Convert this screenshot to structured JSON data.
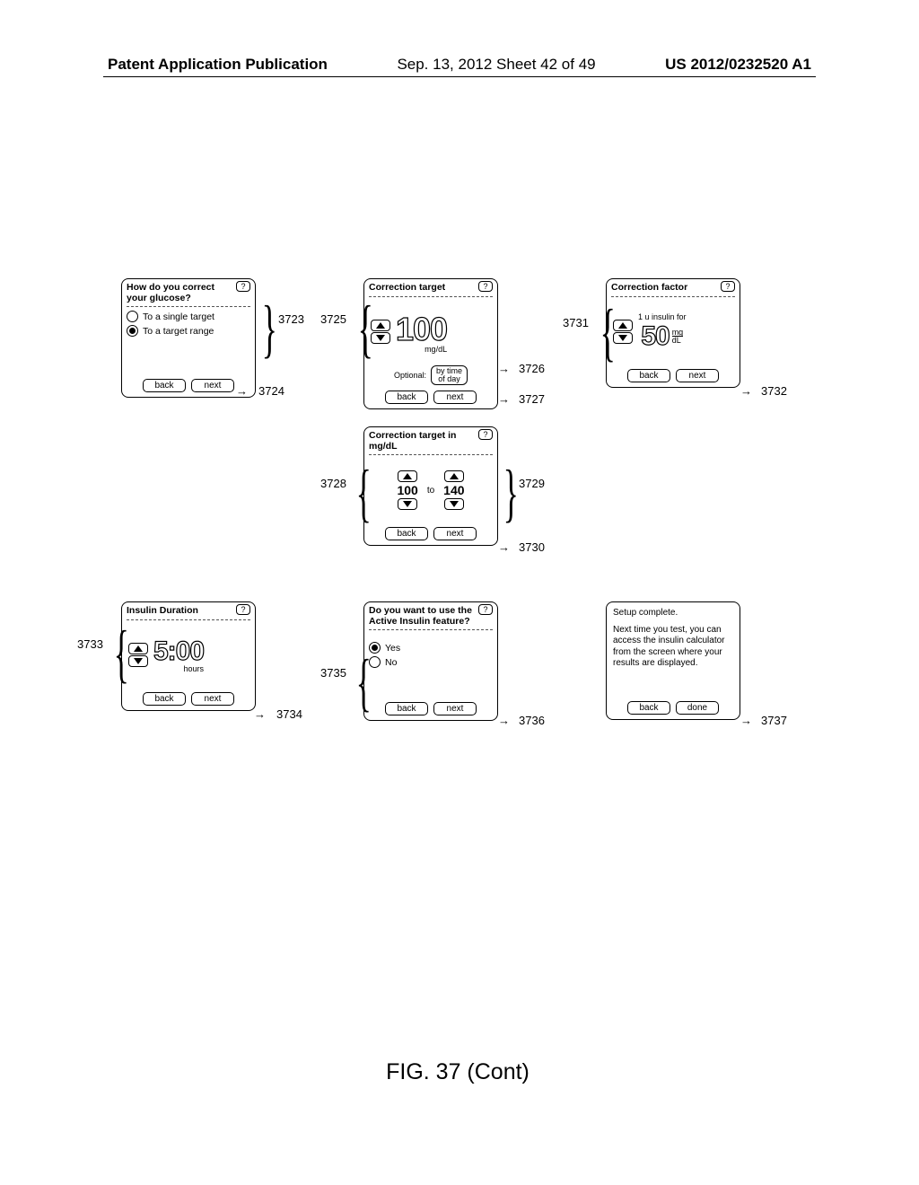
{
  "header": {
    "left": "Patent Application Publication",
    "center": "Sep. 13, 2012  Sheet 42 of 49",
    "right": "US 2012/0232520 A1"
  },
  "figure_caption": "FIG. 37 (Cont)",
  "screens": {
    "s1": {
      "title": "How do you correct your glucose?",
      "opt1": "To a single target",
      "opt2": "To a target range",
      "back": "back",
      "next": "next"
    },
    "s2": {
      "title": "Correction target",
      "value": "100",
      "unit": "mg/dL",
      "optional_label": "Optional:",
      "by_time": "by time\nof day",
      "back": "back",
      "next": "next"
    },
    "s3": {
      "title": "Correction factor",
      "caption": "1 u insulin for",
      "value": "50",
      "unit_top": "mg",
      "unit_bot": "dL",
      "back": "back",
      "next": "next"
    },
    "s4": {
      "title": "Correction target in mg/dL",
      "v1": "100",
      "to": "to",
      "v2": "140",
      "back": "back",
      "next": "next"
    },
    "s5": {
      "title": "Insulin Duration",
      "value": "5:00",
      "unit": "hours",
      "back": "back",
      "next": "next"
    },
    "s6": {
      "title": "Do you want to use the Active Insulin feature?",
      "yes": "Yes",
      "no": "No",
      "back": "back",
      "next": "next"
    },
    "s7": {
      "text1": "Setup complete.",
      "text2": "Next time you test, you can access the insulin calculator from the screen where your results are displayed.",
      "back": "back",
      "done": "done"
    }
  },
  "refs": {
    "r3723": "3723",
    "r3724": "3724",
    "r3725": "3725",
    "r3726": "3726",
    "r3727": "3727",
    "r3728": "3728",
    "r3729": "3729",
    "r3730": "3730",
    "r3731": "3731",
    "r3732": "3732",
    "r3733": "3733",
    "r3734": "3734",
    "r3735": "3735",
    "r3736": "3736",
    "r3737": "3737"
  }
}
